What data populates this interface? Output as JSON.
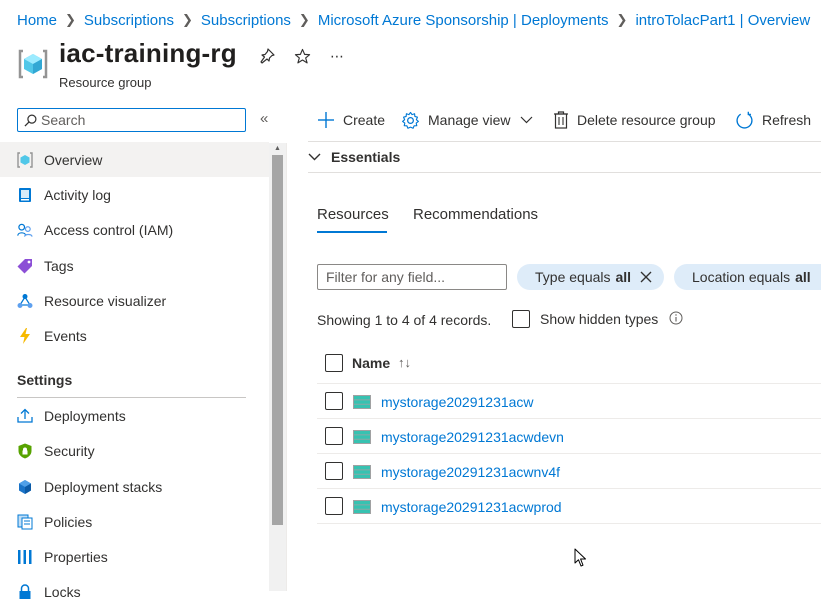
{
  "breadcrumb": [
    "Home",
    "Subscriptions",
    "Subscriptions",
    "Microsoft Azure Sponsorship | Deployments",
    "introTolacPart1 | Overview"
  ],
  "resource": {
    "title": "iac-training-rg",
    "subtitle": "Resource group",
    "icons": [
      "pin-icon",
      "star-icon",
      "more-icon"
    ]
  },
  "sidebar": {
    "search_placeholder": "Search",
    "items": [
      {
        "label": "Overview",
        "icon": "resource-group-icon",
        "active": true
      },
      {
        "label": "Activity log",
        "icon": "activity-log-icon"
      },
      {
        "label": "Access control (IAM)",
        "icon": "people-icon"
      },
      {
        "label": "Tags",
        "icon": "tag-icon"
      },
      {
        "label": "Resource visualizer",
        "icon": "visualizer-icon"
      },
      {
        "label": "Events",
        "icon": "lightning-icon"
      }
    ],
    "section_title": "Settings",
    "settings_items": [
      {
        "label": "Deployments",
        "icon": "upload-icon"
      },
      {
        "label": "Security",
        "icon": "shield-icon"
      },
      {
        "label": "Deployment stacks",
        "icon": "stack-icon"
      },
      {
        "label": "Policies",
        "icon": "policy-icon"
      },
      {
        "label": "Properties",
        "icon": "properties-icon"
      },
      {
        "label": "Locks",
        "icon": "lock-icon"
      }
    ]
  },
  "toolbar": {
    "create": "Create",
    "manage_view": "Manage view",
    "delete": "Delete resource group",
    "refresh": "Refresh"
  },
  "essentials": "Essentials",
  "tabs": {
    "resources": "Resources",
    "recommendations": "Recommendations"
  },
  "filters": {
    "placeholder": "Filter for any field...",
    "type_pill": {
      "label": "Type equals",
      "value": "all"
    },
    "location_pill": {
      "label": "Location equals",
      "value": "all"
    }
  },
  "records_text": "Showing 1 to 4 of 4 records.",
  "show_hidden_types": "Show hidden types",
  "grid": {
    "name_header": "Name",
    "sort_glyph": "↑↓",
    "rows": [
      {
        "name": "mystorage20291231acw"
      },
      {
        "name": "mystorage20291231acwdevn"
      },
      {
        "name": "mystorage20291231acwnv4f"
      },
      {
        "name": "mystorage20291231acwprod"
      }
    ]
  },
  "colors": {
    "accent": "#0078d4",
    "pill_bg": "#deecf9",
    "active_nav": "#f3f2f1"
  }
}
